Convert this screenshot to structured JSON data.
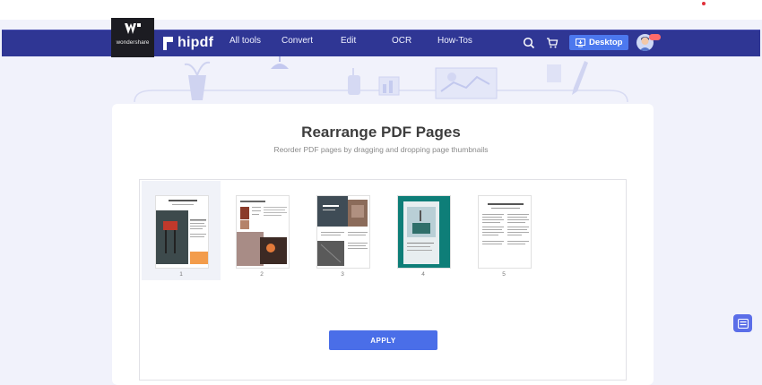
{
  "brand": {
    "parent": "wondershare",
    "name": "hipdf"
  },
  "nav": {
    "items": [
      {
        "label": "All tools"
      },
      {
        "label": "Convert"
      },
      {
        "label": "Edit"
      },
      {
        "label": "OCR"
      },
      {
        "label": "How-Tos"
      }
    ],
    "icons": [
      "search-icon",
      "cart-icon"
    ],
    "desktop_label": "Desktop"
  },
  "main": {
    "title": "Rearrange PDF Pages",
    "subtitle": "Reorder PDF pages by dragging and dropping page thumbnails",
    "pages": [
      {
        "number": "1",
        "selected": true
      },
      {
        "number": "2",
        "selected": false
      },
      {
        "number": "3",
        "selected": false
      },
      {
        "number": "4",
        "selected": false
      },
      {
        "number": "5",
        "selected": false
      }
    ],
    "apply_label": "APPLY"
  },
  "colors": {
    "navbar": "#2f3694",
    "accent": "#4a6ee8",
    "background": "#f1f2fb"
  }
}
